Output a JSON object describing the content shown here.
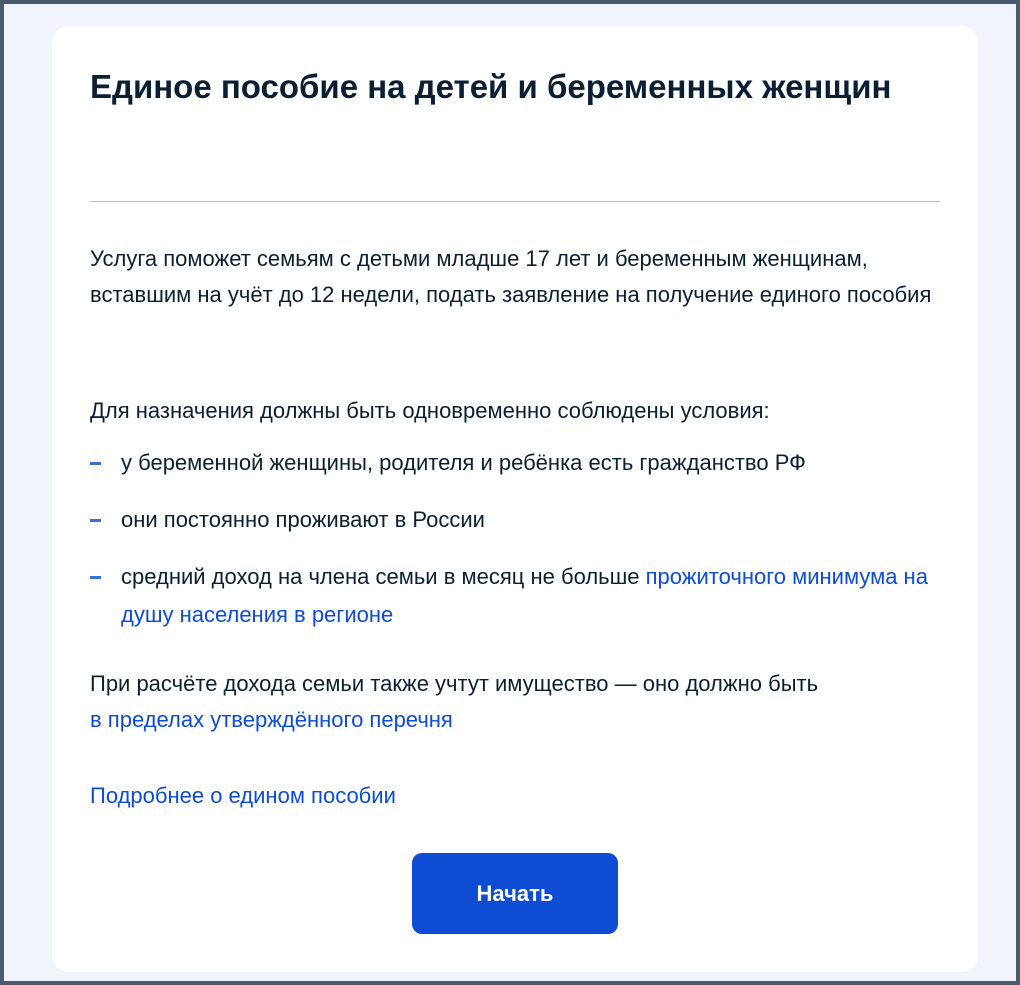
{
  "service": {
    "title": "Единое пособие на детей и беременных женщин",
    "intro": "Услуга поможет семьям с детьми младше 17 лет и беременным женщинам, вставшим на учёт до 12 недели, подать заявление на получение единого пособия",
    "conditions_lead": "Для назначения должны быть одновременно соблюдены условия:",
    "conditions": [
      {
        "text": "у беременной женщины, родителя и ребёнка есть гражданство РФ"
      },
      {
        "text": "они постоянно проживают в России"
      },
      {
        "text": "средний доход на члена семьи в месяц не больше ",
        "link": "прожиточного минимума на душу населения в регионе"
      }
    ],
    "property_text": "При расчёте дохода семьи также учтут имущество — оно должно быть ",
    "property_link": "в пределах утверждённого перечня",
    "more_link": "Подробнее о едином пособии",
    "start_button": "Начать"
  },
  "colors": {
    "accent": "#0d4cd3",
    "text": "#0b1f33",
    "divider": "#a9c2e8",
    "background": "#f1f4fa"
  }
}
